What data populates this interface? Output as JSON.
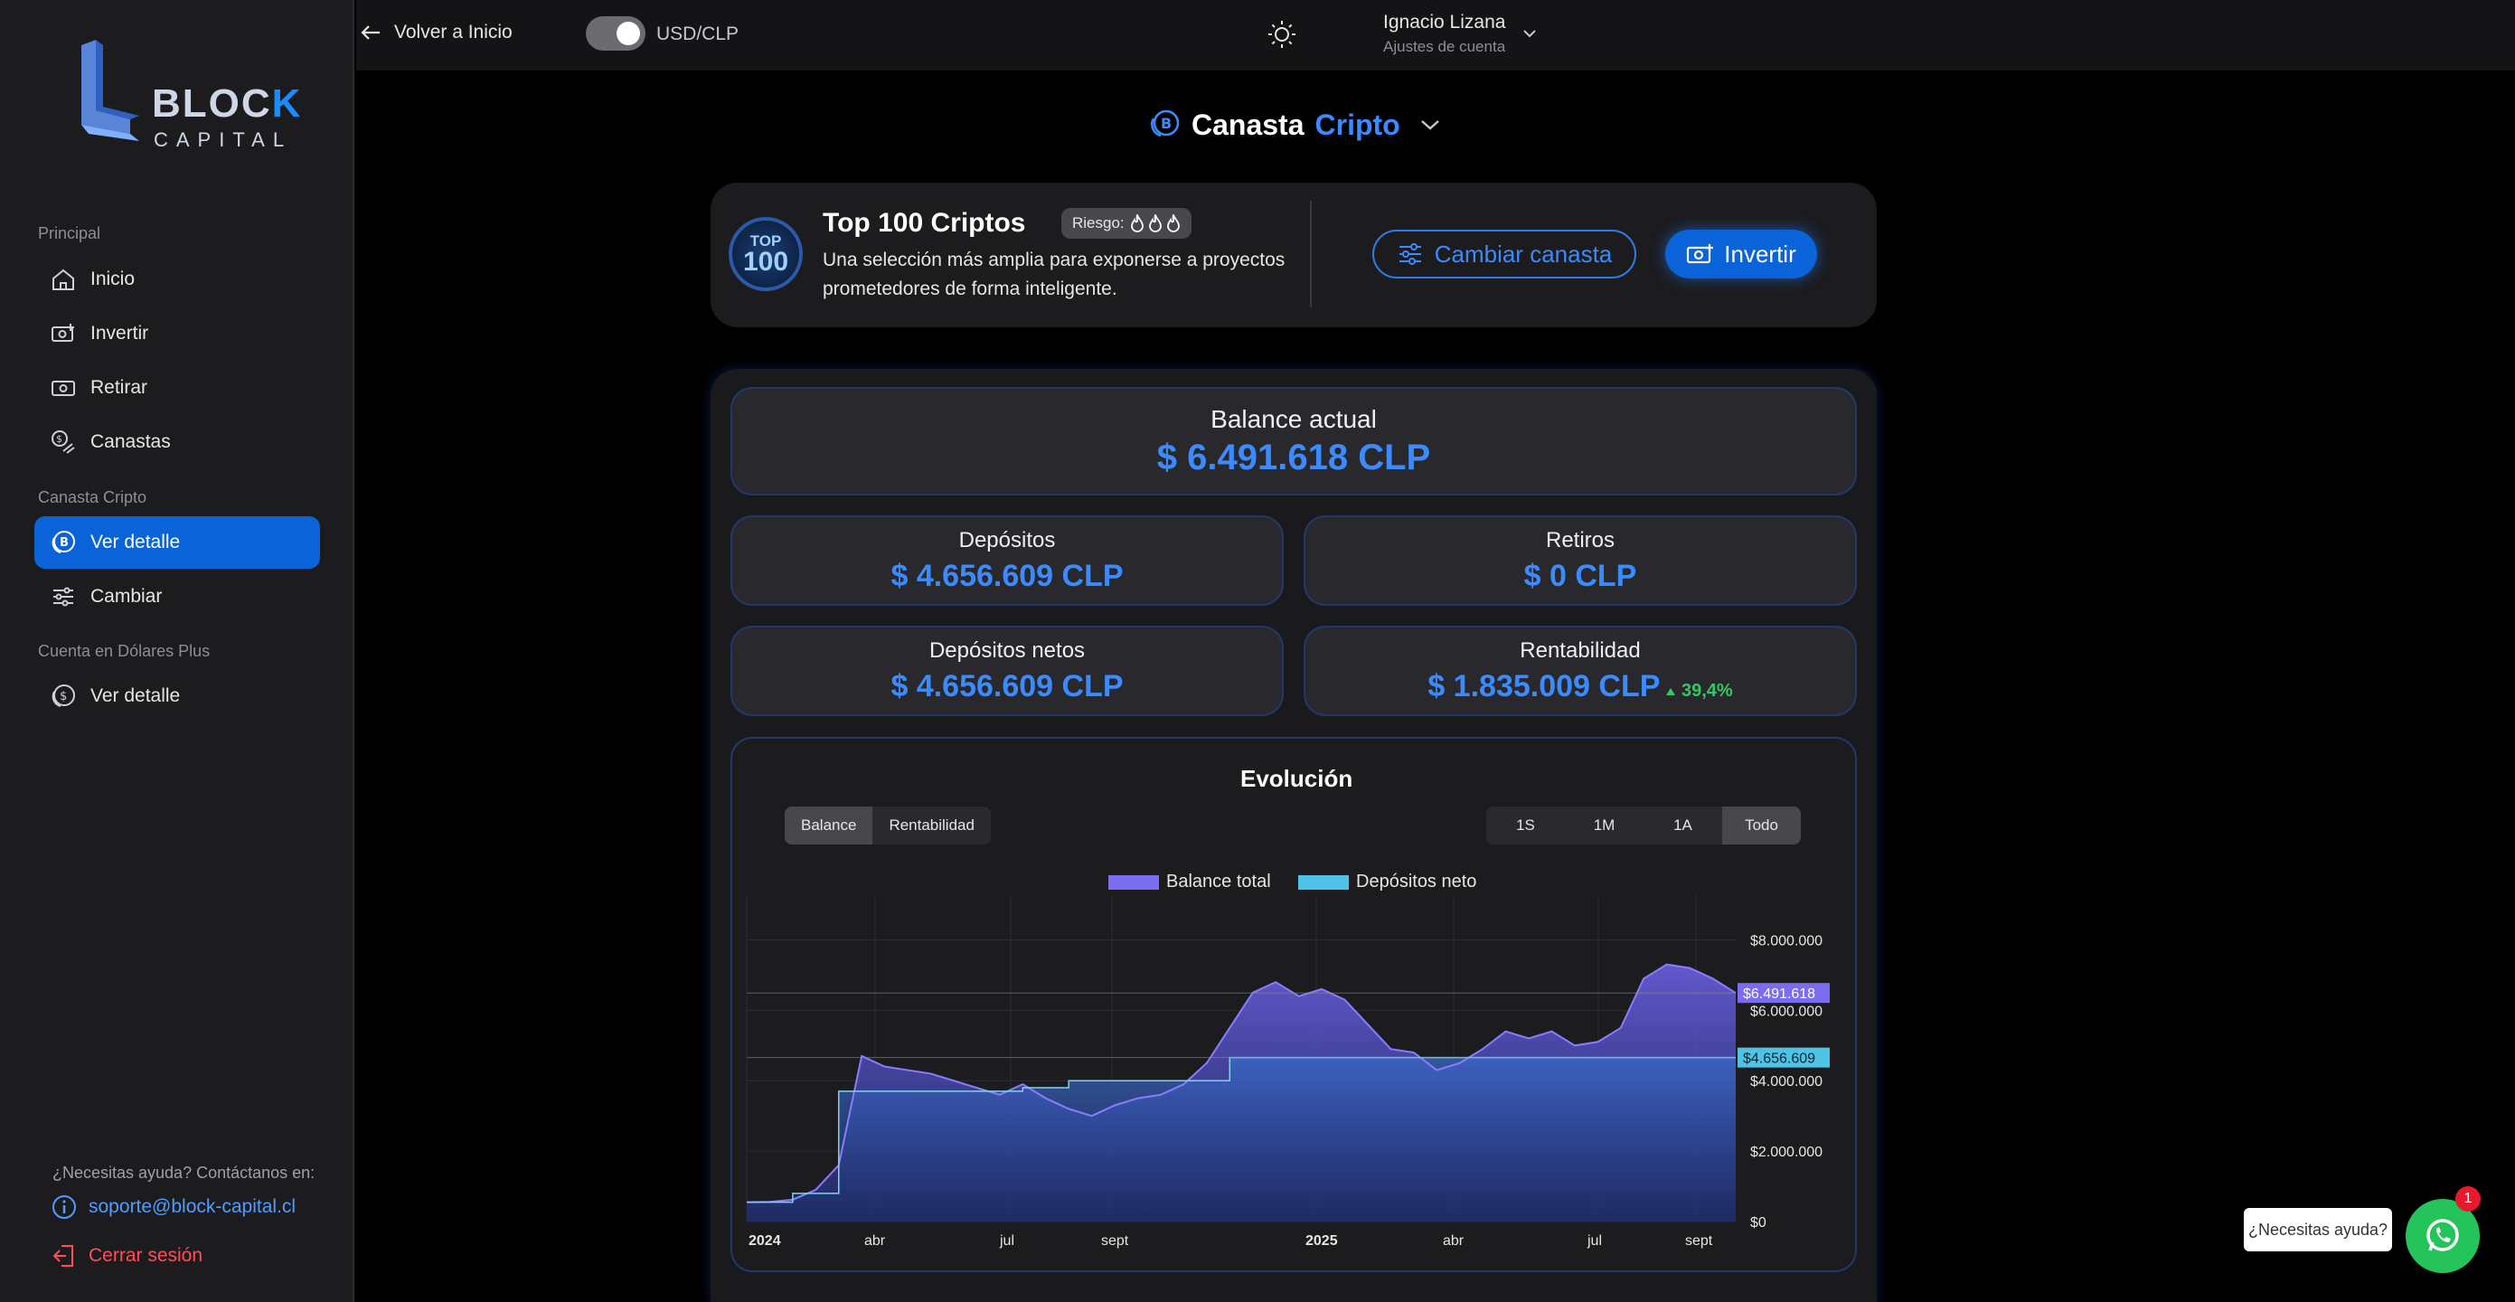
{
  "sidebar": {
    "logo": {
      "line1_a": "BLOC",
      "line1_b": "K",
      "line2": "CAPITAL"
    },
    "sections": {
      "principal": "Principal",
      "canasta": "Canasta Cripto",
      "dolares": "Cuenta en Dólares Plus"
    },
    "items": {
      "inicio": "Inicio",
      "invertir": "Invertir",
      "retirar": "Retirar",
      "canastas": "Canastas",
      "ver_detalle": "Ver detalle",
      "cambiar": "Cambiar",
      "ver_detalle_usd": "Ver detalle"
    },
    "help": "¿Necesitas ayuda? Contáctanos en:",
    "support_email": "soporte@block-capital.cl",
    "logout": "Cerrar sesión"
  },
  "topbar": {
    "back": "Volver a Inicio",
    "currency": "USD/CLP",
    "user_name": "Ignacio Lizana",
    "user_sub": "Ajustes de cuenta"
  },
  "basket": {
    "title_a": "Canasta",
    "title_b": "Cripto"
  },
  "header_card": {
    "badge_top": "TOP",
    "badge_num": "100",
    "title": "Top 100 Criptos",
    "risk": "Riesgo:",
    "description": "Una selección más amplia para exponerse a proyectos prometedores de forma inteligente.",
    "change_button": "Cambiar canasta",
    "invest_button": "Invertir"
  },
  "stats": {
    "balance_label": "Balance actual",
    "balance_value": "$ 6.491.618 CLP",
    "deposits_label": "Depósitos",
    "deposits_value": "$ 4.656.609 CLP",
    "withdrawals_label": "Retiros",
    "withdrawals_value": "$ 0 CLP",
    "net_label": "Depósitos netos",
    "net_value": "$ 4.656.609 CLP",
    "profit_label": "Rentabilidad",
    "profit_value": "$ 1.835.009 CLP",
    "profit_pct": "39,4%"
  },
  "chart_section": {
    "title": "Evolución",
    "mode_tabs": [
      "Balance",
      "Rentabilidad"
    ],
    "range_tabs": [
      "1S",
      "1M",
      "1A",
      "Todo"
    ],
    "legend": [
      "Balance total",
      "Depósitos neto"
    ],
    "y_ticks": [
      "$8.000.000",
      "$6.000.000",
      "$4.000.000",
      "$2.000.000",
      "$0"
    ],
    "x_ticks": [
      "2024",
      "abr",
      "jul",
      "sept",
      "2025",
      "abr",
      "jul",
      "sept"
    ],
    "last_balance_label": "$6.491.618",
    "last_deposit_label": "$4.656.609"
  },
  "colors": {
    "accent": "#3b8bff",
    "balance": "#7b6cf0",
    "deposits": "#4fc3e6",
    "positive": "#32c864"
  },
  "chart_data": {
    "type": "area",
    "title": "Evolución",
    "ylim": [
      0,
      8500000
    ],
    "x_ticks": [
      "2024",
      "abr",
      "jul",
      "sept",
      "2025",
      "abr",
      "jul",
      "sept"
    ],
    "series": [
      {
        "name": "Balance total",
        "values": [
          550000,
          560000,
          620000,
          900000,
          1600000,
          4700000,
          4400000,
          4300000,
          4200000,
          4000000,
          3800000,
          3600000,
          3900000,
          3500000,
          3200000,
          3000000,
          3300000,
          3500000,
          3600000,
          3900000,
          4500000,
          5500000,
          6500000,
          6800000,
          6400000,
          6600000,
          6300000,
          5600000,
          4900000,
          4800000,
          4300000,
          4500000,
          4900000,
          5400000,
          5200000,
          5400000,
          5000000,
          5100000,
          5500000,
          6900000,
          7300000,
          7200000,
          6900000,
          6491618
        ]
      },
      {
        "name": "Depósitos neto",
        "values": [
          550000,
          550000,
          800000,
          800000,
          3700000,
          3700000,
          3700000,
          3700000,
          3700000,
          3700000,
          3700000,
          3700000,
          3800000,
          3800000,
          4000000,
          4000000,
          4000000,
          4000000,
          4000000,
          4000000,
          4000000,
          4656609,
          4656609,
          4656609,
          4656609,
          4656609,
          4656609,
          4656609,
          4656609,
          4656609,
          4656609,
          4656609,
          4656609,
          4656609,
          4656609,
          4656609,
          4656609,
          4656609,
          4656609,
          4656609,
          4656609,
          4656609,
          4656609,
          4656609
        ]
      }
    ]
  }
}
